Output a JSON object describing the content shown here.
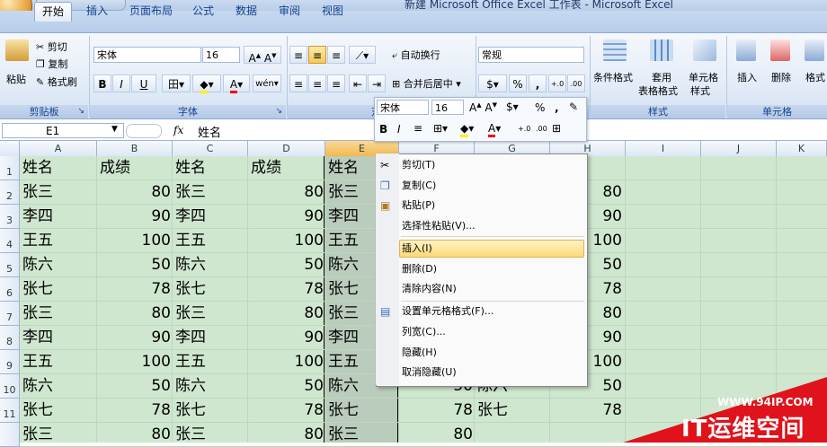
{
  "window": {
    "title": "新建 Microsoft Office Excel 工作表 - Microsoft Excel"
  },
  "tabs": [
    "开始",
    "插入",
    "页面布局",
    "公式",
    "数据",
    "审阅",
    "视图"
  ],
  "ribbon": {
    "clipboard": {
      "paste": "粘贴",
      "cut": "剪切",
      "copy": "复制",
      "format_painter": "格式刷",
      "label": "剪贴板"
    },
    "font": {
      "name": "宋体",
      "size": "16",
      "bold": "B",
      "italic": "I",
      "underline": "U",
      "label": "字体"
    },
    "alignment": {
      "wrap": "自动换行",
      "merge": "合并后居中",
      "label": "对齐"
    },
    "number": {
      "format": "常规",
      "percent": "%",
      "comma": ",",
      "label": "数"
    },
    "styles": {
      "conditional": "条件格式",
      "table": "套用",
      "table2": "表格格式",
      "cell": "单元格",
      "cell2": "样式",
      "label": "样式"
    },
    "cells": {
      "insert": "插入",
      "delete": "删除",
      "format": "格式",
      "label": "单元格"
    }
  },
  "formula_bar": {
    "name_box": "E1",
    "fx": "fx",
    "value": "姓名"
  },
  "columns": [
    "A",
    "B",
    "C",
    "D",
    "E",
    "F",
    "G",
    "H",
    "I",
    "J",
    "K"
  ],
  "rows": [
    "1",
    "2",
    "3",
    "4",
    "5",
    "6",
    "7",
    "8",
    "9",
    "10",
    "11"
  ],
  "cells": {
    "A": [
      "姓名",
      "张三",
      "李四",
      "王五",
      "陈六",
      "张七",
      "张三",
      "李四",
      "王五",
      "陈六",
      "张七",
      "张三"
    ],
    "B": [
      "成绩",
      "80",
      "90",
      "100",
      "50",
      "78",
      "80",
      "90",
      "100",
      "50",
      "78",
      "80"
    ],
    "C": [
      "姓名",
      "张三",
      "李四",
      "王五",
      "陈六",
      "张七",
      "张三",
      "李四",
      "王五",
      "陈六",
      "张七",
      "张三"
    ],
    "D": [
      "成绩",
      "80",
      "90",
      "100",
      "50",
      "78",
      "80",
      "90",
      "100",
      "50",
      "78",
      "80"
    ],
    "E": [
      "姓名",
      "张三",
      "李四",
      "王五",
      "陈六",
      "张七",
      "张三",
      "李四",
      "王五",
      "陈六",
      "张七",
      "张三"
    ],
    "F_tail": [
      "50",
      "78",
      "80"
    ],
    "G_tail": [
      "陈六",
      "张七"
    ],
    "H": [
      "80",
      "90",
      "100",
      "50",
      "78",
      "80",
      "90",
      "100",
      "50",
      "78"
    ]
  },
  "mini_toolbar": {
    "font": "宋体",
    "size": "16",
    "percent": "%",
    "comma": ","
  },
  "context_menu": [
    "剪切(T)",
    "复制(C)",
    "粘贴(P)",
    "选择性粘贴(V)...",
    "插入(I)",
    "删除(D)",
    "清除内容(N)",
    "设置单元格格式(F)...",
    "列宽(C)...",
    "隐藏(H)",
    "取消隐藏(U)"
  ],
  "watermark": {
    "url": "WWW.94IP.COM",
    "name": "IT运维空间"
  }
}
